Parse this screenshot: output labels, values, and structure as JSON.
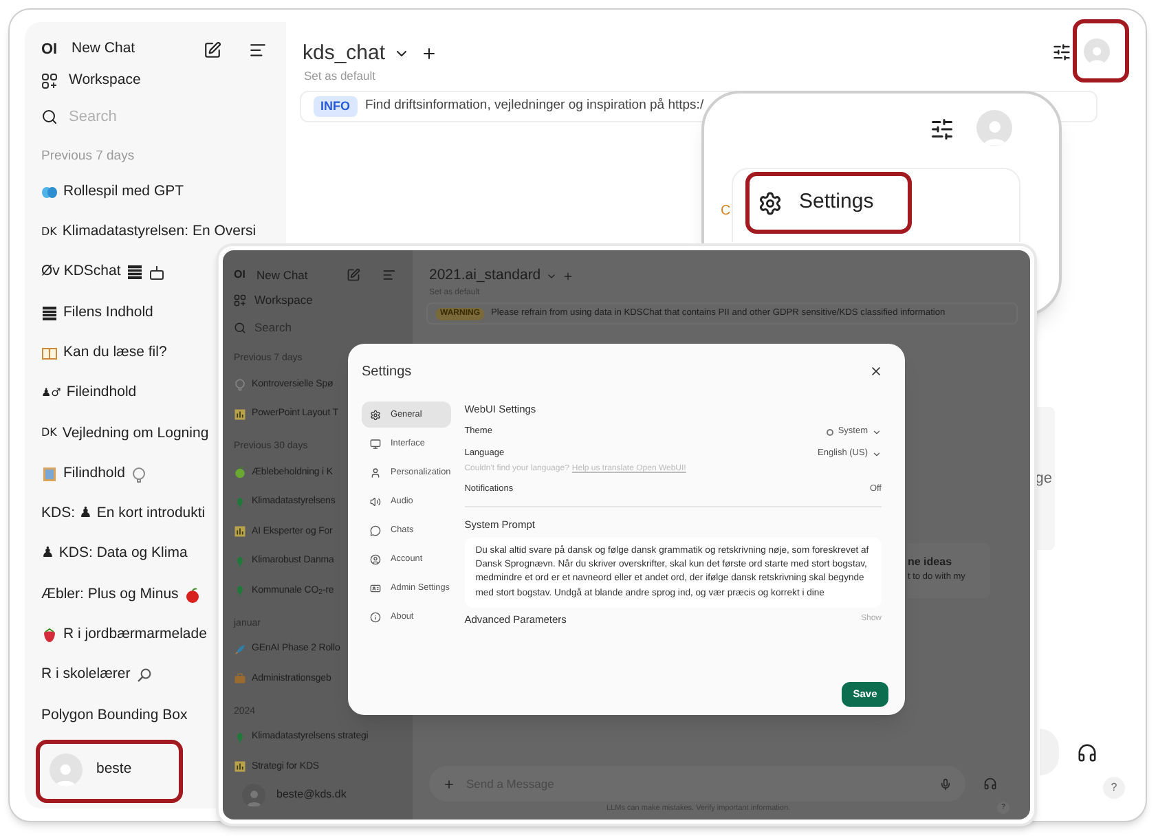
{
  "back_window": {
    "sidebar": {
      "logo": "OI",
      "new_chat": "New Chat",
      "workspace": "Workspace",
      "search": {
        "placeholder": "Search"
      },
      "section": "Previous 7 days",
      "chats": [
        {
          "title": "Rollespil med GPT"
        },
        {
          "title": "Klimadatastyrelsen: En Oversi",
          "prefix": "DK"
        },
        {
          "title": "Øv KDSchat"
        },
        {
          "title": "Filens Indhold"
        },
        {
          "title": "Kan du læse fil?"
        },
        {
          "title": "Fileindhold",
          "prefix": "♟♂"
        },
        {
          "title": "Vejledning om Logning",
          "prefix": "DK"
        },
        {
          "title": "Filindhold"
        },
        {
          "title": "KDS: ♟ En kort introdukti"
        },
        {
          "title": "♟ KDS: Data og Klima"
        },
        {
          "title": "Æbler: Plus og Minus"
        },
        {
          "title": "R i jordbærmarmelade"
        },
        {
          "title": "R i skolelærer"
        },
        {
          "title": "Polygon Bounding Box"
        }
      ],
      "user": "beste"
    },
    "header": {
      "model": "kds_chat",
      "set_default": "Set as default"
    },
    "banner": {
      "tag": "INFO",
      "text": "Find driftsinformation, vejledninger og inspiration på https:/"
    },
    "fragment": "ge"
  },
  "popup": {
    "fragment": "C",
    "menu_item": "Settings"
  },
  "inner_window": {
    "sidebar": {
      "logo": "OI",
      "new_chat": "New Chat",
      "workspace": "Workspace",
      "search": {
        "placeholder": "Search"
      },
      "groups": [
        {
          "label": "Previous 7 days",
          "chats": [
            {
              "title": "Kontroversielle Spø"
            },
            {
              "title": "PowerPoint Layout T"
            }
          ]
        },
        {
          "label": "Previous 30 days",
          "chats": [
            {
              "title": "Æblebeholdning i K"
            },
            {
              "title": "Klimadatastyrelsens"
            },
            {
              "title": "AI Eksperter og For"
            },
            {
              "title": "Klimarobust Danma"
            },
            {
              "title": "Kommunale CO$_{2}$-re"
            }
          ]
        },
        {
          "label": "januar",
          "chats": [
            {
              "title": "GEnAI Phase 2 Rollo"
            },
            {
              "title": "Administrationsgeb"
            }
          ]
        },
        {
          "label": "2024",
          "chats": [
            {
              "title": "Klimadatastyrelsens strategi"
            },
            {
              "title": "Strategi for KDS"
            }
          ]
        }
      ],
      "user": "beste@kds.dk"
    },
    "header": {
      "model": "2021.ai_standard",
      "set_default": "Set as default"
    },
    "banner": {
      "tag": "WARNING",
      "text": "Please refrain from using data in KDSChat that contains PII and other GDPR sensitive/KDS classified information"
    },
    "fragments": [
      "ne ideas",
      "t to do with my"
    ],
    "input": {
      "placeholder": "Send a Message"
    },
    "footer": "LLMs can make mistakes. Verify important information.",
    "help": "?"
  },
  "settings_dialog": {
    "title": "Settings",
    "tabs": [
      {
        "label": "General",
        "selected": true
      },
      {
        "label": "Interface",
        "selected": false
      },
      {
        "label": "Personalization",
        "selected": false
      },
      {
        "label": "Audio",
        "selected": false
      },
      {
        "label": "Chats",
        "selected": false
      },
      {
        "label": "Account",
        "selected": false
      },
      {
        "label": "Admin Settings",
        "selected": false
      },
      {
        "label": "About",
        "selected": false
      }
    ],
    "section": "WebUI Settings",
    "rows": [
      {
        "label": "Theme",
        "value": "System",
        "kind": "dropdown",
        "dot": true
      },
      {
        "label": "Language",
        "value": "English (US)",
        "kind": "dropdown",
        "dot": false,
        "hint": "Couldn't find your language?",
        "hint_link": "Help us translate Open WebUI!"
      },
      {
        "label": "Notifications",
        "value": "Off",
        "kind": "text",
        "dot": false
      }
    ],
    "system_prompt": {
      "label": "System Prompt",
      "value": "Du skal altid svare på dansk og følge dansk grammatik og retskrivning nøje, som foreskrevet af Dansk Sprognævn. Når du skriver overskrifter, skal kun det første ord starte med stort bogstav, medmindre et ord er et navneord eller et andet ord, der ifølge dansk retskrivning skal begynde med stort bogstav. Undgå at blande andre sprog ind, og vær præcis og korrekt i dine"
    },
    "advanced": {
      "label": "Advanced Parameters",
      "action": "Show"
    },
    "save": "Save"
  },
  "help": "?"
}
